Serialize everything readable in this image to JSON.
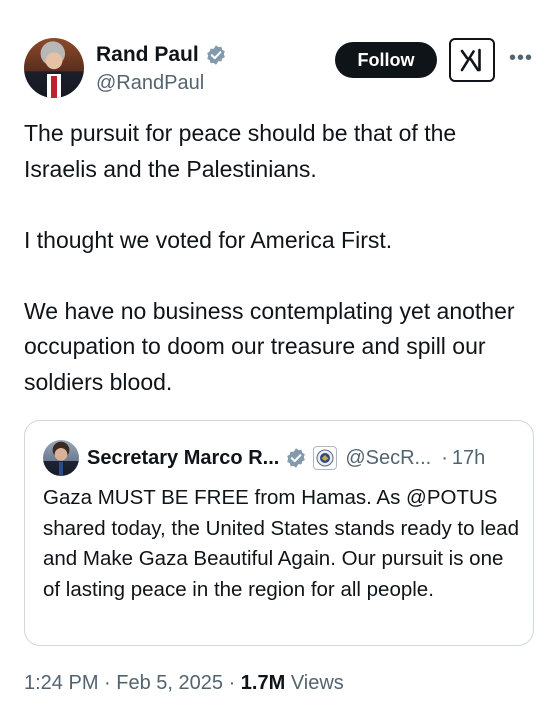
{
  "author": {
    "display_name": "Rand Paul",
    "handle": "@RandPaul",
    "verified_color": "#829aab"
  },
  "actions": {
    "follow_label": "Follow"
  },
  "tweet": {
    "lines": [
      "The pursuit for peace should be that of the Israelis and the Palestinians.",
      "I thought we voted for America First.",
      "We have no business contemplating yet another occupation to doom our treasure and spill our soldiers blood."
    ]
  },
  "quote": {
    "display_name": "Secretary Marco R...",
    "handle": "@SecR...",
    "separator": "·",
    "time": "17h",
    "text": "Gaza MUST BE FREE from Hamas. As @POTUS shared today, the United States stands ready to lead and Make Gaza Beautiful Again. Our pursuit is one of lasting peace in the region for all people.",
    "verified_color": "#829aab"
  },
  "meta": {
    "time": "1:24 PM",
    "sep1": " · ",
    "date": "Feb 5, 2025",
    "sep2": " · ",
    "views_count": "1.7M",
    "views_label": " Views"
  },
  "colors": {
    "text": "#0f1419",
    "secondary": "#536471",
    "border": "#cfd9de"
  }
}
